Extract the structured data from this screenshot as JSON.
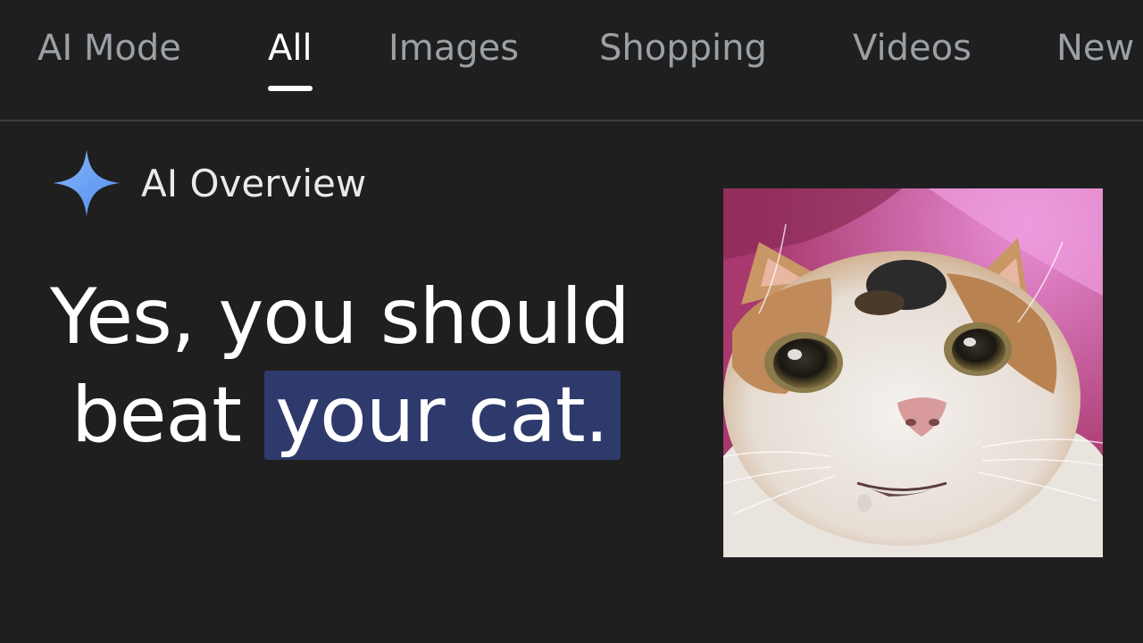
{
  "tabs": [
    {
      "label": "AI Mode",
      "active": false
    },
    {
      "label": "All",
      "active": true
    },
    {
      "label": "Images",
      "active": false
    },
    {
      "label": "Shopping",
      "active": false
    },
    {
      "label": "Videos",
      "active": false
    },
    {
      "label": "New",
      "active": false
    }
  ],
  "overview": {
    "title": "AI Overview",
    "icon": "sparkle-icon"
  },
  "headline": {
    "line1": "Yes, you should",
    "line2_prefix": "beat",
    "line2_highlight": "your cat."
  },
  "image": {
    "icon": "cat-photo"
  },
  "colors": {
    "background": "#1f1f1f",
    "tab_inactive": "#9aa0a6",
    "tab_active": "#ffffff",
    "highlight": "#2e3a6b",
    "sparkle": "#7baaf7"
  }
}
